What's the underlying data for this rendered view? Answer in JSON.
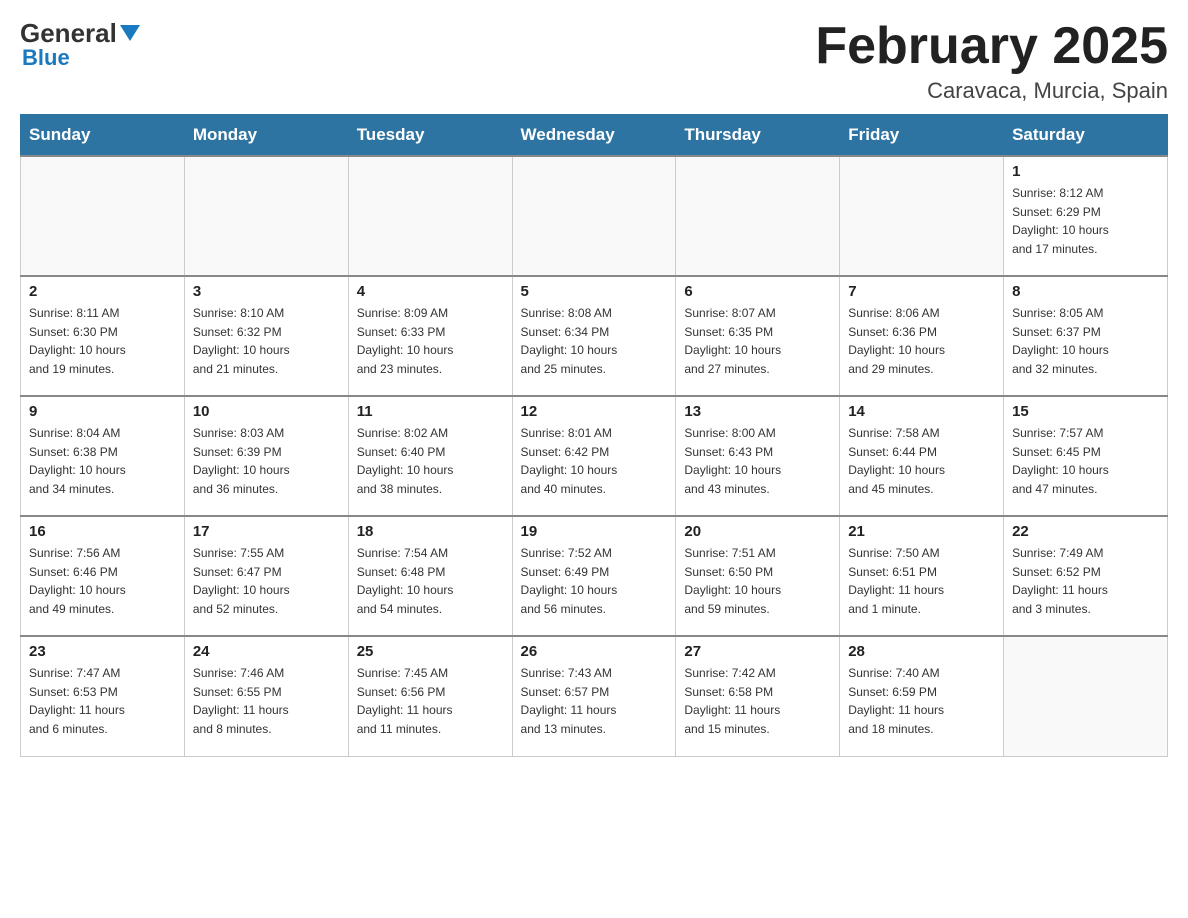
{
  "logo": {
    "general": "General",
    "blue": "Blue",
    "triangle": "▲"
  },
  "title": "February 2025",
  "location": "Caravaca, Murcia, Spain",
  "days_of_week": [
    "Sunday",
    "Monday",
    "Tuesday",
    "Wednesday",
    "Thursday",
    "Friday",
    "Saturday"
  ],
  "weeks": [
    [
      {
        "day": "",
        "info": ""
      },
      {
        "day": "",
        "info": ""
      },
      {
        "day": "",
        "info": ""
      },
      {
        "day": "",
        "info": ""
      },
      {
        "day": "",
        "info": ""
      },
      {
        "day": "",
        "info": ""
      },
      {
        "day": "1",
        "info": "Sunrise: 8:12 AM\nSunset: 6:29 PM\nDaylight: 10 hours\nand 17 minutes."
      }
    ],
    [
      {
        "day": "2",
        "info": "Sunrise: 8:11 AM\nSunset: 6:30 PM\nDaylight: 10 hours\nand 19 minutes."
      },
      {
        "day": "3",
        "info": "Sunrise: 8:10 AM\nSunset: 6:32 PM\nDaylight: 10 hours\nand 21 minutes."
      },
      {
        "day": "4",
        "info": "Sunrise: 8:09 AM\nSunset: 6:33 PM\nDaylight: 10 hours\nand 23 minutes."
      },
      {
        "day": "5",
        "info": "Sunrise: 8:08 AM\nSunset: 6:34 PM\nDaylight: 10 hours\nand 25 minutes."
      },
      {
        "day": "6",
        "info": "Sunrise: 8:07 AM\nSunset: 6:35 PM\nDaylight: 10 hours\nand 27 minutes."
      },
      {
        "day": "7",
        "info": "Sunrise: 8:06 AM\nSunset: 6:36 PM\nDaylight: 10 hours\nand 29 minutes."
      },
      {
        "day": "8",
        "info": "Sunrise: 8:05 AM\nSunset: 6:37 PM\nDaylight: 10 hours\nand 32 minutes."
      }
    ],
    [
      {
        "day": "9",
        "info": "Sunrise: 8:04 AM\nSunset: 6:38 PM\nDaylight: 10 hours\nand 34 minutes."
      },
      {
        "day": "10",
        "info": "Sunrise: 8:03 AM\nSunset: 6:39 PM\nDaylight: 10 hours\nand 36 minutes."
      },
      {
        "day": "11",
        "info": "Sunrise: 8:02 AM\nSunset: 6:40 PM\nDaylight: 10 hours\nand 38 minutes."
      },
      {
        "day": "12",
        "info": "Sunrise: 8:01 AM\nSunset: 6:42 PM\nDaylight: 10 hours\nand 40 minutes."
      },
      {
        "day": "13",
        "info": "Sunrise: 8:00 AM\nSunset: 6:43 PM\nDaylight: 10 hours\nand 43 minutes."
      },
      {
        "day": "14",
        "info": "Sunrise: 7:58 AM\nSunset: 6:44 PM\nDaylight: 10 hours\nand 45 minutes."
      },
      {
        "day": "15",
        "info": "Sunrise: 7:57 AM\nSunset: 6:45 PM\nDaylight: 10 hours\nand 47 minutes."
      }
    ],
    [
      {
        "day": "16",
        "info": "Sunrise: 7:56 AM\nSunset: 6:46 PM\nDaylight: 10 hours\nand 49 minutes."
      },
      {
        "day": "17",
        "info": "Sunrise: 7:55 AM\nSunset: 6:47 PM\nDaylight: 10 hours\nand 52 minutes."
      },
      {
        "day": "18",
        "info": "Sunrise: 7:54 AM\nSunset: 6:48 PM\nDaylight: 10 hours\nand 54 minutes."
      },
      {
        "day": "19",
        "info": "Sunrise: 7:52 AM\nSunset: 6:49 PM\nDaylight: 10 hours\nand 56 minutes."
      },
      {
        "day": "20",
        "info": "Sunrise: 7:51 AM\nSunset: 6:50 PM\nDaylight: 10 hours\nand 59 minutes."
      },
      {
        "day": "21",
        "info": "Sunrise: 7:50 AM\nSunset: 6:51 PM\nDaylight: 11 hours\nand 1 minute."
      },
      {
        "day": "22",
        "info": "Sunrise: 7:49 AM\nSunset: 6:52 PM\nDaylight: 11 hours\nand 3 minutes."
      }
    ],
    [
      {
        "day": "23",
        "info": "Sunrise: 7:47 AM\nSunset: 6:53 PM\nDaylight: 11 hours\nand 6 minutes."
      },
      {
        "day": "24",
        "info": "Sunrise: 7:46 AM\nSunset: 6:55 PM\nDaylight: 11 hours\nand 8 minutes."
      },
      {
        "day": "25",
        "info": "Sunrise: 7:45 AM\nSunset: 6:56 PM\nDaylight: 11 hours\nand 11 minutes."
      },
      {
        "day": "26",
        "info": "Sunrise: 7:43 AM\nSunset: 6:57 PM\nDaylight: 11 hours\nand 13 minutes."
      },
      {
        "day": "27",
        "info": "Sunrise: 7:42 AM\nSunset: 6:58 PM\nDaylight: 11 hours\nand 15 minutes."
      },
      {
        "day": "28",
        "info": "Sunrise: 7:40 AM\nSunset: 6:59 PM\nDaylight: 11 hours\nand 18 minutes."
      },
      {
        "day": "",
        "info": ""
      }
    ]
  ]
}
